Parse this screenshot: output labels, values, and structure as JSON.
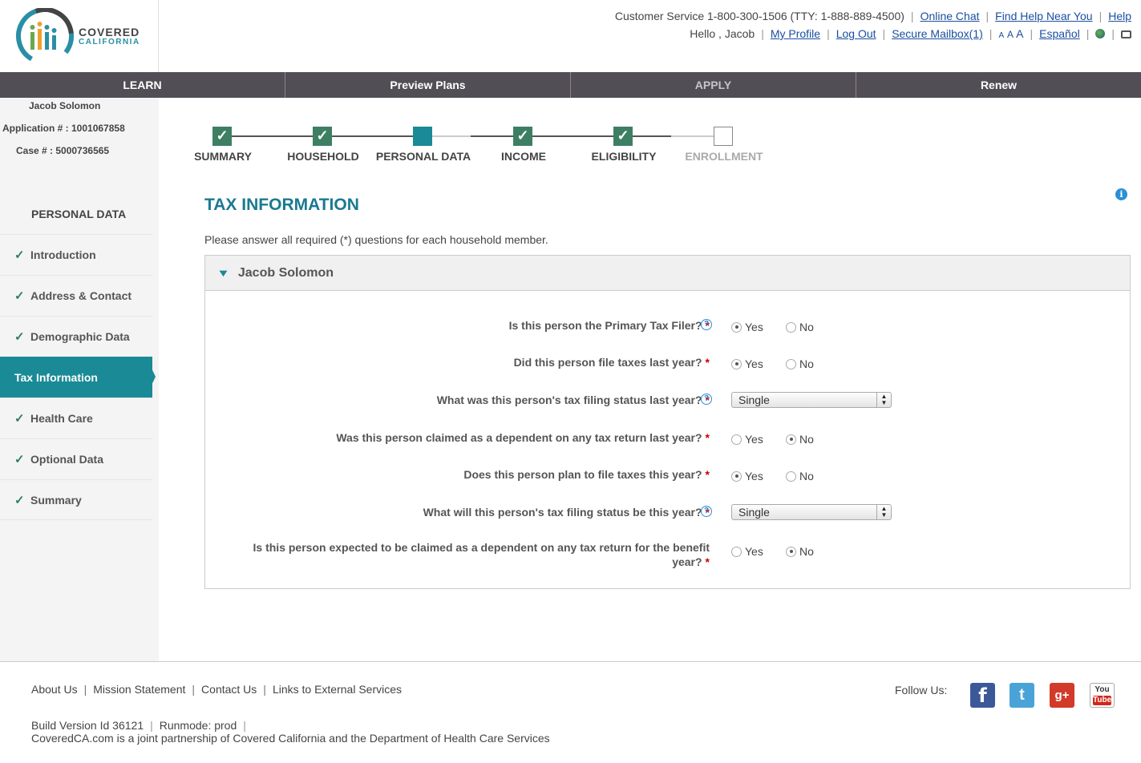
{
  "header": {
    "logo": {
      "line1": "COVERED",
      "line2": "CALIFORNIA"
    },
    "customer_service": "Customer Service 1-800-300-1506 (TTY: 1-888-889-4500)",
    "online_chat": "Online Chat",
    "find_help": "Find Help Near You",
    "help": "Help",
    "greeting": "Hello , Jacob",
    "my_profile": "My Profile",
    "log_out": "Log Out",
    "secure_mailbox": "Secure Mailbox(1)",
    "text_size": [
      "A",
      "A",
      "A"
    ],
    "espanol": "Español"
  },
  "nav": {
    "tabs": [
      {
        "label": "LEARN"
      },
      {
        "label": "Preview Plans"
      },
      {
        "label": "APPLY"
      },
      {
        "label": "Renew"
      }
    ]
  },
  "sidebar": {
    "user_name": "Jacob Solomon",
    "application": "Application # : 1001067858",
    "case": "Case # : 5000736565",
    "heading": "PERSONAL DATA",
    "items": [
      {
        "label": "Introduction",
        "check": "✓"
      },
      {
        "label": "Address & Contact",
        "check": "✓"
      },
      {
        "label": "Demographic Data",
        "check": "✓"
      },
      {
        "label": "Tax Information",
        "check": ""
      },
      {
        "label": "Health Care",
        "check": "✓"
      },
      {
        "label": "Optional Data",
        "check": "✓"
      },
      {
        "label": "Summary",
        "check": "✓"
      }
    ]
  },
  "progress": {
    "steps": [
      {
        "label": "SUMMARY",
        "status": "done"
      },
      {
        "label": "HOUSEHOLD",
        "status": "done"
      },
      {
        "label": "PERSONAL DATA",
        "status": "current"
      },
      {
        "label": "INCOME",
        "status": "done"
      },
      {
        "label": "ELIGIBILITY",
        "status": "done"
      },
      {
        "label": "ENROLLMENT",
        "status": "todo"
      }
    ],
    "check_glyph": "✓"
  },
  "main": {
    "title": "TAX INFORMATION",
    "instructions": "Please answer all required (*) questions for each household member.",
    "info_icon": "i",
    "panel_name": "Jacob Solomon",
    "required_mark": "*",
    "yes_label": "Yes",
    "no_label": "No",
    "help_glyph": "?",
    "questions": [
      {
        "text": "Is this person the Primary Tax Filer?",
        "type": "radio",
        "value": "Yes",
        "help": true
      },
      {
        "text": "Did this person file taxes last year?",
        "type": "radio",
        "value": "Yes",
        "help": false
      },
      {
        "text": "What was this person's tax filing status last year?",
        "type": "select",
        "value": "Single",
        "help": true
      },
      {
        "text": "Was this person claimed as a dependent on any tax return last year?",
        "type": "radio",
        "value": "No",
        "help": false
      },
      {
        "text": "Does this person plan to file taxes this year?",
        "type": "radio",
        "value": "Yes",
        "help": false
      },
      {
        "text": "What will this person's tax filing status be this year?",
        "type": "select",
        "value": "Single",
        "help": true
      },
      {
        "text_line1": "Is this person expected to be claimed as a dependent on any tax return for the benefit",
        "text_line2": "year?",
        "type": "radio",
        "value": "No",
        "help": false
      }
    ]
  },
  "footer": {
    "links": [
      "About Us",
      "Mission Statement",
      "Contact Us",
      "Links to External Services"
    ],
    "build": "Build Version Id 36121",
    "runmode": "Runmode: prod",
    "note": "CoveredCA.com is a joint partnership of Covered California and the Department of Health Care Services",
    "follow": "Follow Us:",
    "social": {
      "facebook": "f",
      "twitter": "t",
      "googleplus": "g+",
      "youtube_top": "You",
      "youtube_bottom": "Tube"
    }
  }
}
